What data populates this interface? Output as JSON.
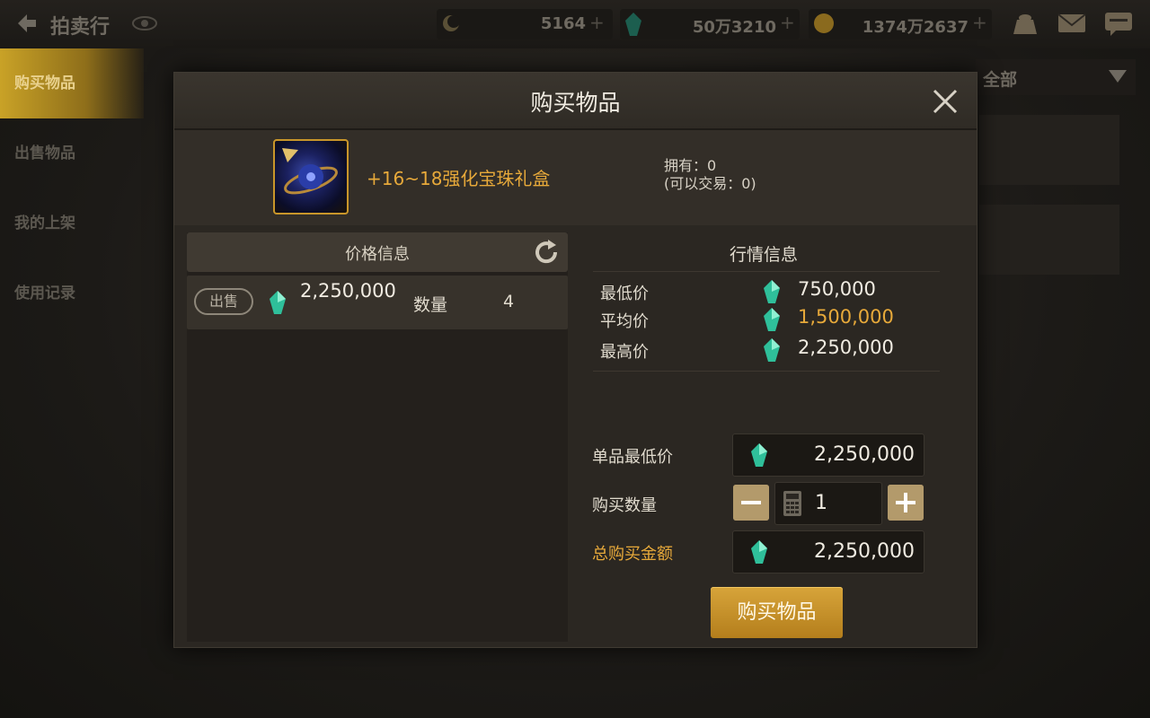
{
  "topbar": {
    "title": "拍卖行",
    "currency1": "5164",
    "currency2": "50万3210",
    "currency3": "1374万2637",
    "plus": "+"
  },
  "sidebar": {
    "items": [
      {
        "label": "购买物品"
      },
      {
        "label": "出售物品"
      },
      {
        "label": "我的上架"
      },
      {
        "label": "使用记录"
      }
    ]
  },
  "filter": {
    "selected": "全部"
  },
  "modal": {
    "title": "购买物品",
    "item_name": "+16~18强化宝珠礼盒",
    "own_line1": "拥有：0",
    "own_line2": "(可以交易：0)",
    "price_panel": {
      "title": "价格信息",
      "rows": [
        {
          "action": "出售",
          "price": "2,250,000",
          "qty_label": "数量",
          "qty": "4"
        }
      ]
    },
    "market": {
      "title": "行情信息",
      "rows": [
        {
          "label": "最低价",
          "value": "750,000"
        },
        {
          "label": "平均价",
          "value": "1,500,000"
        },
        {
          "label": "最高价",
          "value": "2,250,000"
        }
      ]
    },
    "form": {
      "unit_price_label": "单品最低价",
      "unit_price": "2,250,000",
      "qty_label": "购买数量",
      "qty": "1",
      "total_label": "总购买金额",
      "total": "2,250,000"
    },
    "buy_button": "购买物品"
  },
  "colors": {
    "accent_gold": "#e7a93a",
    "gem": "#2fbf9a",
    "button_gold": "#c9932b"
  }
}
